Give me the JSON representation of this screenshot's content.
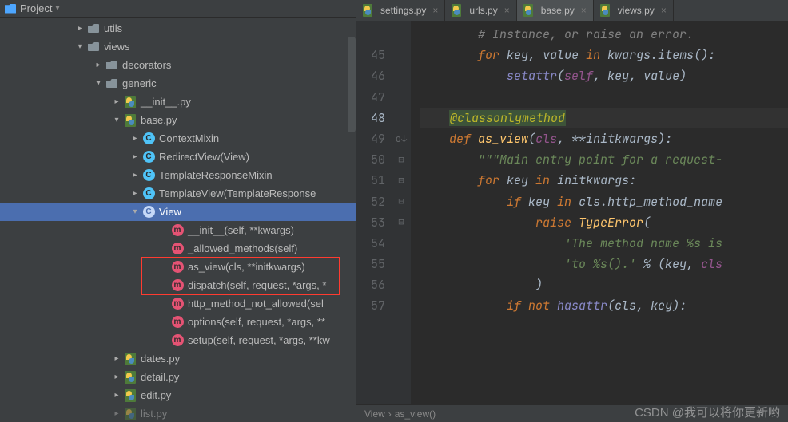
{
  "project": {
    "title": "Project"
  },
  "tree": {
    "utils": "utils",
    "views": "views",
    "decorators": "decorators",
    "generic": "generic",
    "init": "__init__.py",
    "base": "base.py",
    "class_ContextMixin": "ContextMixin",
    "class_RedirectView": "RedirectView(View)",
    "class_TemplateResponseMixin": "TemplateResponseMixin",
    "class_TemplateView": "TemplateView(TemplateResponse",
    "class_View": "View",
    "m_init": "__init__(self, **kwargs)",
    "m_allowed": "_allowed_methods(self)",
    "m_asview": "as_view(cls, **initkwargs)",
    "m_dispatch": "dispatch(self, request, *args, *",
    "m_http": "http_method_not_allowed(sel",
    "m_options": "options(self, request, *args, **",
    "m_setup": "setup(self, request, *args, **kw",
    "dates": "dates.py",
    "detail": "detail.py",
    "edit": "edit.py",
    "list": "list.py"
  },
  "tabs": [
    {
      "label": "settings.py",
      "active": false
    },
    {
      "label": "urls.py",
      "active": false
    },
    {
      "label": "base.py",
      "active": true
    },
    {
      "label": "views.py",
      "active": false
    }
  ],
  "gutter": {
    "lines": [
      " ",
      "45",
      "46",
      "47",
      "48",
      "49",
      "50",
      "51",
      "52",
      "53",
      "54",
      "55",
      "56",
      "57"
    ],
    "current": "48"
  },
  "code": {
    "l0_cmt": "        # Instance, or raise an error.",
    "l1_for": "for",
    "l1_key": " key",
    "l1_c1": ", ",
    "l1_val": "value ",
    "l1_in": "in",
    "l1_rest": " kwargs.items():",
    "l2_setattr": "setattr",
    "l2_open": "(",
    "l2_self": "self",
    "l2_rest": ", key, value)",
    "l4_deco": "@classonlymethod",
    "l5_def": "def ",
    "l5_fn": "as_view",
    "l5_open": "(",
    "l5_cls": "cls",
    "l5_rest": ", **initkwargs):",
    "l6_doc": "\"\"\"Main entry point for a request-",
    "l7_for": "for",
    "l7_mid": " key ",
    "l7_in": "in",
    "l7_rest": " initkwargs:",
    "l8_if": "if",
    "l8_mid": " key ",
    "l8_in": "in",
    "l8_rest": " cls.http_method_name",
    "l9_raise": "raise ",
    "l9_err": "TypeError",
    "l9_p": "(",
    "l10_str": "'The method name %s is",
    "l11_str": "'to %s().' ",
    "l11_mod": "% (key",
    "l11_c": ", ",
    "l11_cls": "cls",
    "l12_p": ")",
    "l13_if": "if not ",
    "l13_has": "hasattr",
    "l13_p": "(cls",
    "l13_c": ", ",
    "l13_rest": "key):"
  },
  "breadcrumb": {
    "a": "View",
    "sep": "›",
    "b": "as_view()"
  },
  "watermark": "CSDN @我可以将你更新哟"
}
